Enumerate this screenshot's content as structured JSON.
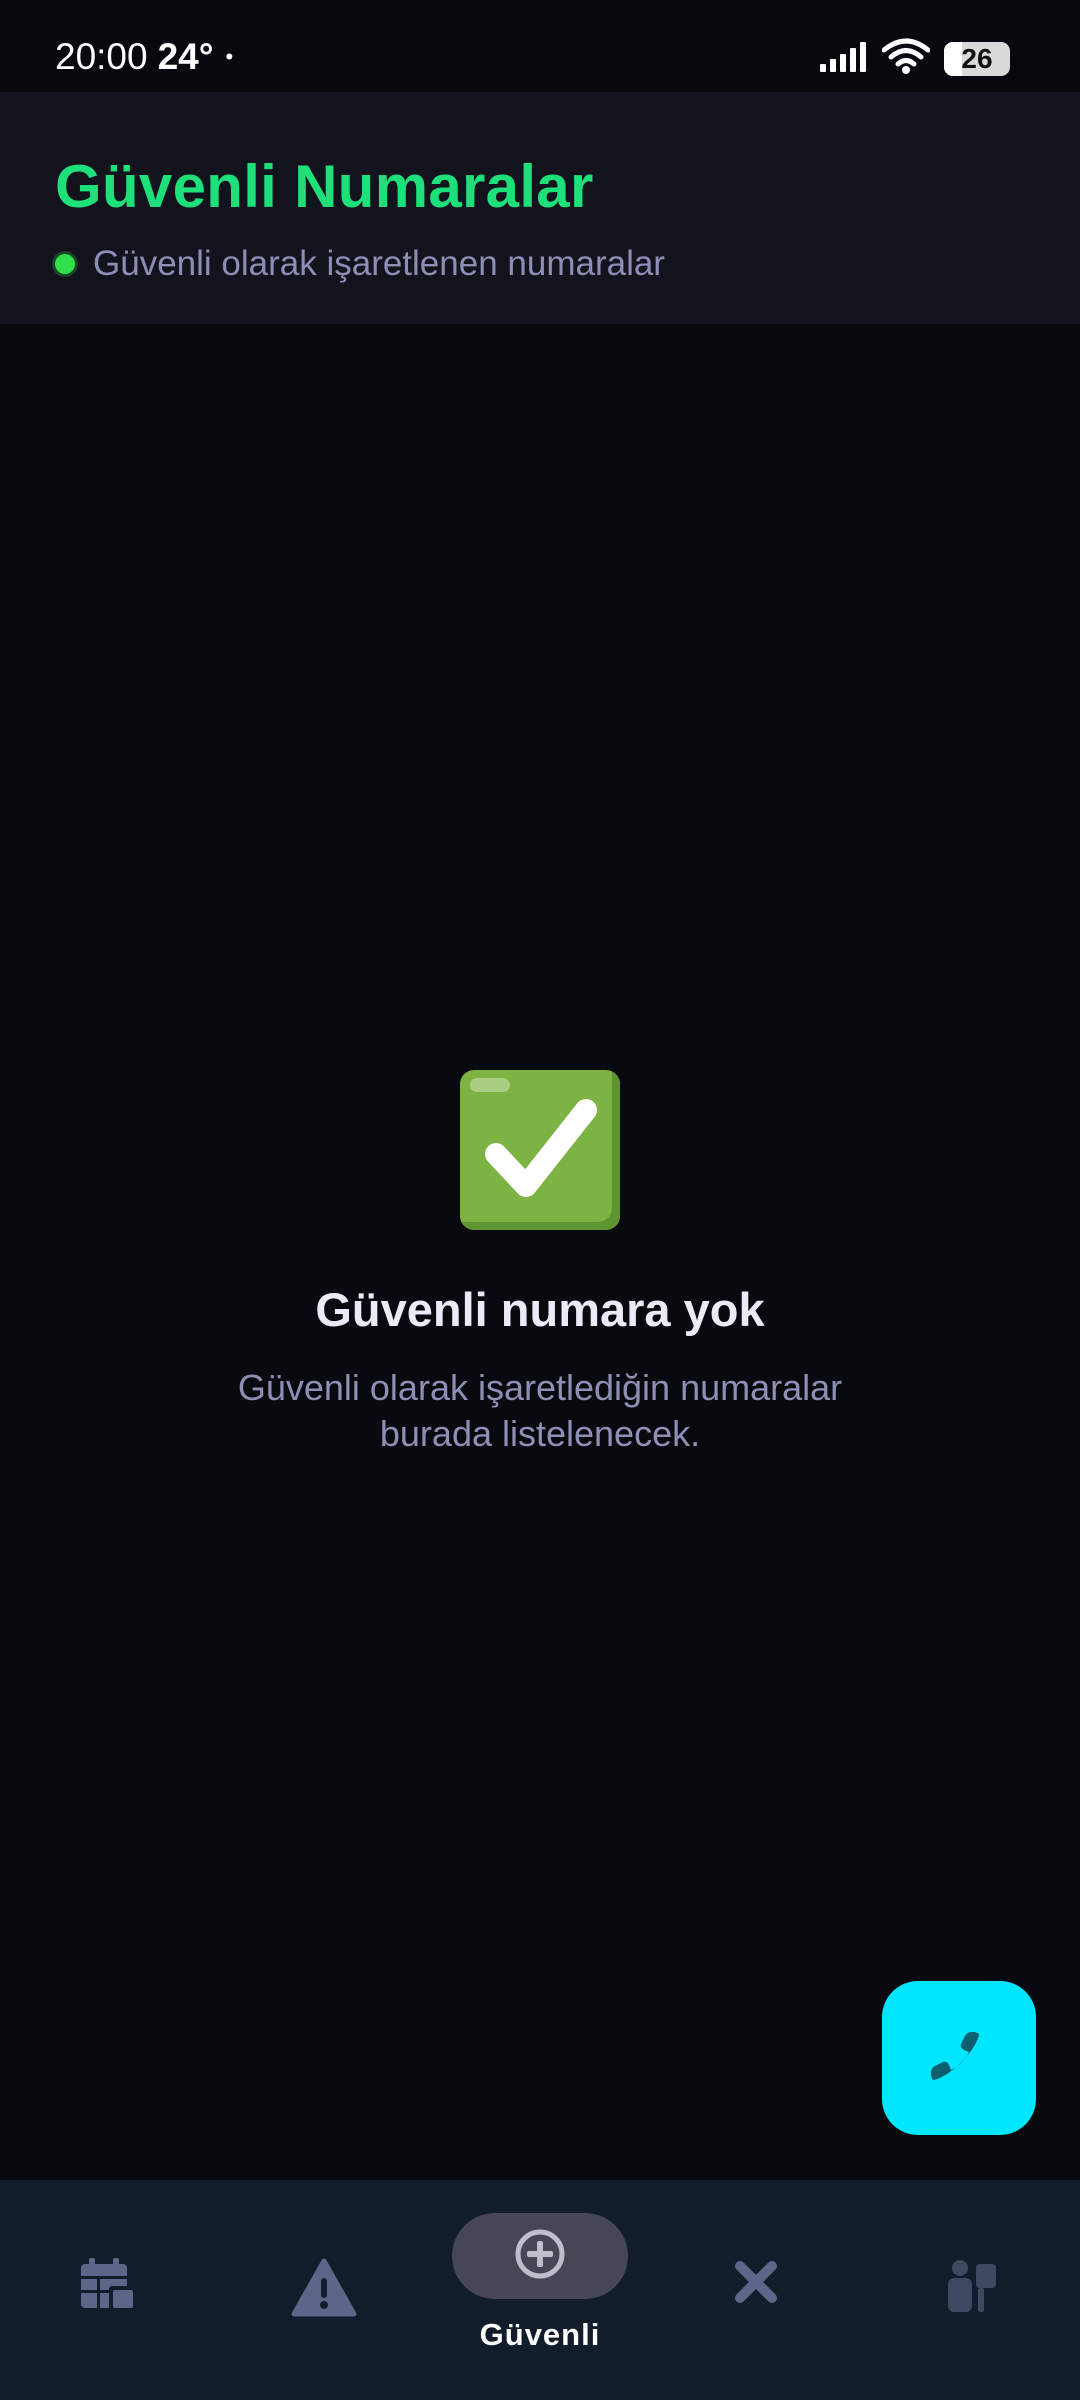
{
  "status_bar": {
    "time": "20:00",
    "temperature": "24°",
    "dot": "•",
    "battery": "26",
    "icons": [
      "signal-icon",
      "wifi-icon",
      "battery-icon"
    ]
  },
  "header": {
    "title": "Güvenli Numaralar",
    "subtitle": "Güvenli olarak işaretlenen numaralar",
    "title_color": "#1ee07a",
    "dot_color": "#2fe04a"
  },
  "empty_state": {
    "icon": "check-mark-icon",
    "title": "Güvenli numara yok",
    "description": "Güvenli olarak işaretlediğin numaralar burada listelenecek."
  },
  "fab": {
    "icon": "phone-icon",
    "color": "#00e6ff"
  },
  "bottom_nav": {
    "items": [
      {
        "icon": "calendar-icon",
        "label": ""
      },
      {
        "icon": "warning-icon",
        "label": ""
      },
      {
        "icon": "add-circle-icon",
        "label": "Güvenli",
        "active": true
      },
      {
        "icon": "close-icon",
        "label": ""
      },
      {
        "icon": "settings-icon",
        "label": ""
      }
    ]
  }
}
